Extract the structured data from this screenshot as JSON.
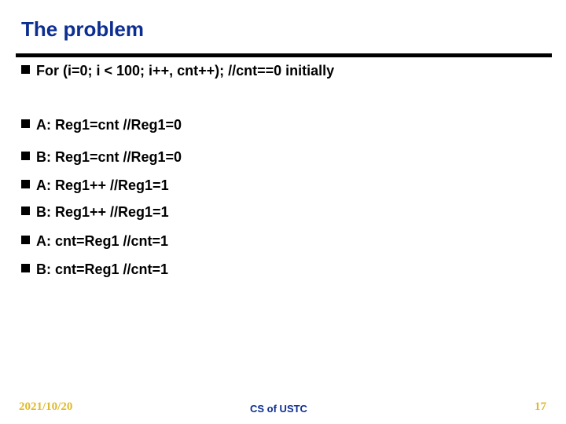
{
  "slide": {
    "title": "The problem",
    "bullets": [
      "For (i=0; i < 100; i++, cnt++); //cnt==0 initially",
      "A: Reg1=cnt //Reg1=0",
      "B: Reg1=cnt //Reg1=0",
      "A: Reg1++ //Reg1=1",
      "B: Reg1++ //Reg1=1",
      "A: cnt=Reg1 //cnt=1",
      "B: cnt=Reg1 //cnt=1"
    ],
    "bullet_icon": "square-bullet-icon"
  },
  "footer": {
    "date": "2021/10/20",
    "center": "CS of USTC",
    "page": "17"
  },
  "colors": {
    "title": "#0d2e91",
    "rule": "#000000",
    "footer_gold": "#e0b92a",
    "footer_blue": "#0d2e91"
  }
}
